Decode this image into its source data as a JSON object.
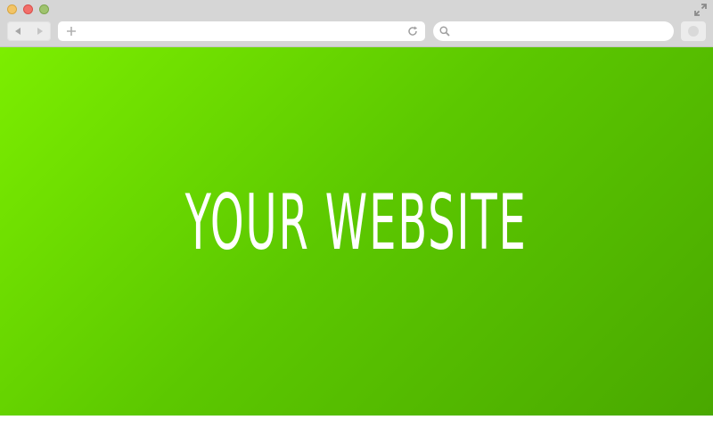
{
  "window": {
    "controls": {
      "minimize_color": "#f2c466",
      "close_color": "#f26f6a",
      "zoom_color": "#9fc36e"
    },
    "fullscreen_icon": "expand-arrows-icon"
  },
  "toolbar": {
    "back_icon": "back-arrow-icon",
    "forward_icon": "forward-arrow-icon",
    "new_tab_icon": "plus-icon",
    "reload_icon": "reload-icon",
    "extension_icon": "circle-button-icon"
  },
  "address_bar": {
    "value": "",
    "placeholder": ""
  },
  "search_bar": {
    "value": "",
    "placeholder": ""
  },
  "page": {
    "title": "YOUR WEBSITE",
    "gradient_start": "#7cee00",
    "gradient_end": "#49a800",
    "title_color": "#ffffff"
  }
}
